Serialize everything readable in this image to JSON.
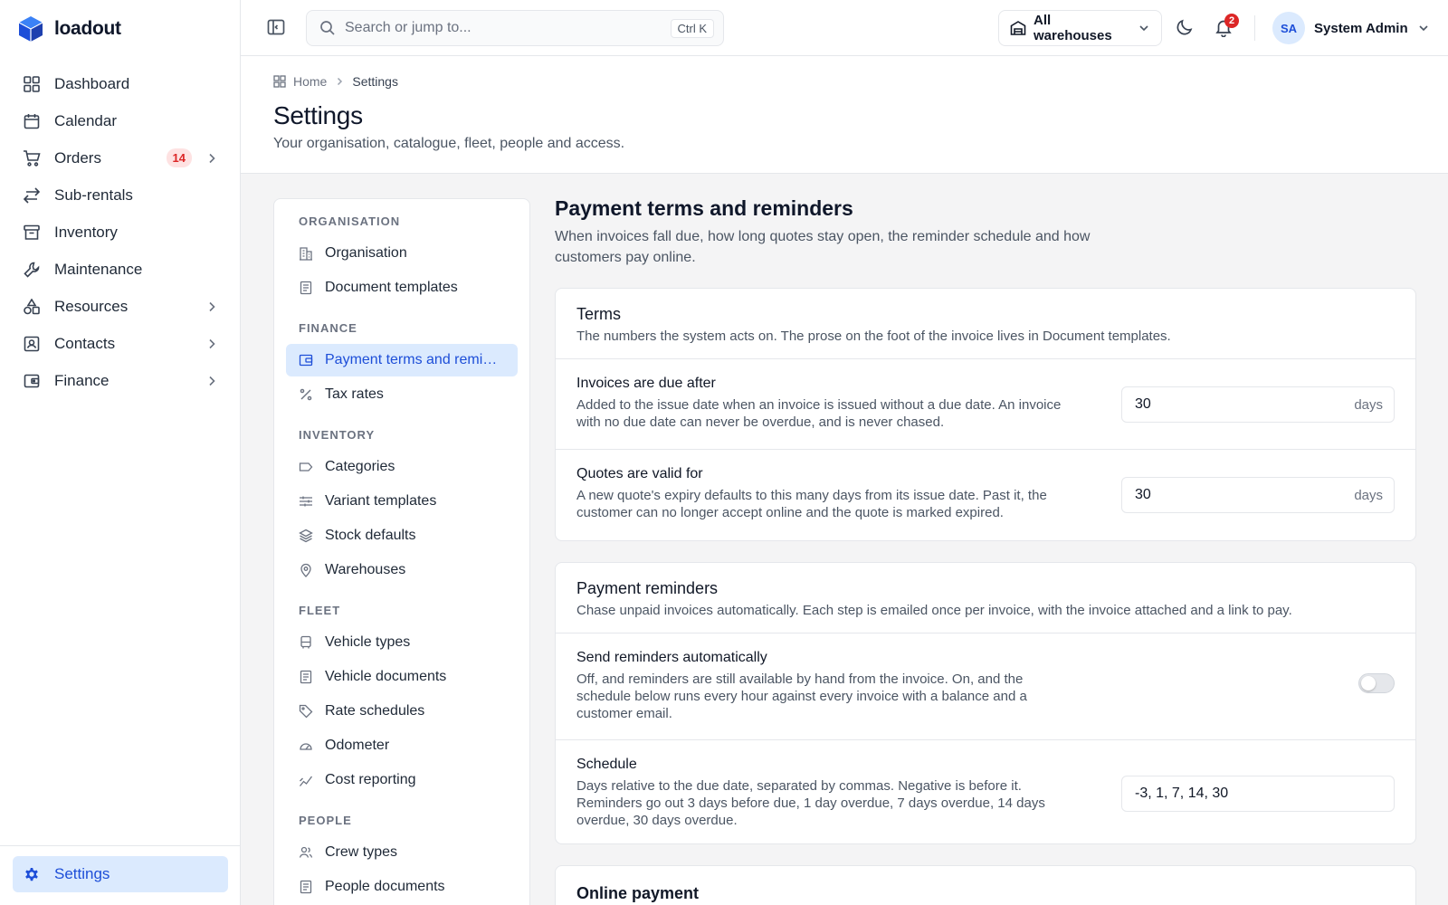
{
  "brand": {
    "name": "loadout",
    "accent": "#1d4ed8"
  },
  "sidebar": {
    "items": [
      {
        "label": "Dashboard",
        "icon": "dashboard-icon"
      },
      {
        "label": "Calendar",
        "icon": "calendar-icon"
      },
      {
        "label": "Orders",
        "icon": "cart-icon",
        "badge": "14",
        "has_children": true
      },
      {
        "label": "Sub-rentals",
        "icon": "arrows-exchange-icon"
      },
      {
        "label": "Inventory",
        "icon": "archive-box-icon"
      },
      {
        "label": "Maintenance",
        "icon": "wrench-icon"
      },
      {
        "label": "Resources",
        "icon": "shapes-icon",
        "has_children": true
      },
      {
        "label": "Contacts",
        "icon": "contact-card-icon",
        "has_children": true
      },
      {
        "label": "Finance",
        "icon": "wallet-icon",
        "has_children": true
      }
    ],
    "bottom": {
      "label": "Settings",
      "icon": "gear-icon",
      "active": true
    }
  },
  "topbar": {
    "search_placeholder": "Search or jump to...",
    "shortcut": "Ctrl K",
    "warehouse_select": "All warehouses",
    "notifications_count": "2",
    "user": {
      "initials": "SA",
      "name": "System Admin"
    }
  },
  "page": {
    "breadcrumb": {
      "home": "Home",
      "current": "Settings"
    },
    "title": "Settings",
    "subtitle": "Your organisation, catalogue, fleet, people and access."
  },
  "settings_nav": {
    "organisation": {
      "heading": "ORGANISATION",
      "items": [
        "Organisation",
        "Document templates"
      ]
    },
    "finance": {
      "heading": "FINANCE",
      "items": [
        "Payment terms and reminders",
        "Tax rates"
      ]
    },
    "inventory": {
      "heading": "INVENTORY",
      "items": [
        "Categories",
        "Variant templates",
        "Stock defaults",
        "Warehouses"
      ]
    },
    "fleet": {
      "heading": "FLEET",
      "items": [
        "Vehicle types",
        "Vehicle documents",
        "Rate schedules",
        "Odometer",
        "Cost reporting"
      ]
    },
    "people": {
      "heading": "PEOPLE",
      "items": [
        "Crew types",
        "People documents"
      ]
    },
    "active_item": "Payment terms and reminders"
  },
  "main": {
    "title": "Payment terms and reminders",
    "description": "When invoices fall due, how long quotes stay open, the reminder schedule and how customers pay online.",
    "terms": {
      "title": "Terms",
      "description": "The numbers the system acts on. The prose on the foot of the invoice lives in Document templates.",
      "invoices_due": {
        "label": "Invoices are due after",
        "help": "Added to the issue date when an invoice is issued without a due date. An invoice with no due date can never be overdue, and is never chased.",
        "value": "30",
        "unit": "days"
      },
      "quotes_valid": {
        "label": "Quotes are valid for",
        "help": "A new quote's expiry defaults to this many days from its issue date. Past it, the customer can no longer accept online and the quote is marked expired.",
        "value": "30",
        "unit": "days"
      }
    },
    "reminders": {
      "title": "Payment reminders",
      "description": "Chase unpaid invoices automatically. Each step is emailed once per invoice, with the invoice attached and a link to pay.",
      "send_auto": {
        "label": "Send reminders automatically",
        "help": "Off, and reminders are still available by hand from the invoice. On, and the schedule below runs every hour against every invoice with a balance and a customer email.",
        "enabled": false
      },
      "schedule": {
        "label": "Schedule",
        "help": "Days relative to the due date, separated by commas. Negative is before it. Reminders go out 3 days before due, 1 day overdue, 7 days overdue, 14 days overdue, 30 days overdue.",
        "value": "-3, 1, 7, 14, 30"
      }
    },
    "online_payment": {
      "title": "Online payment"
    }
  }
}
